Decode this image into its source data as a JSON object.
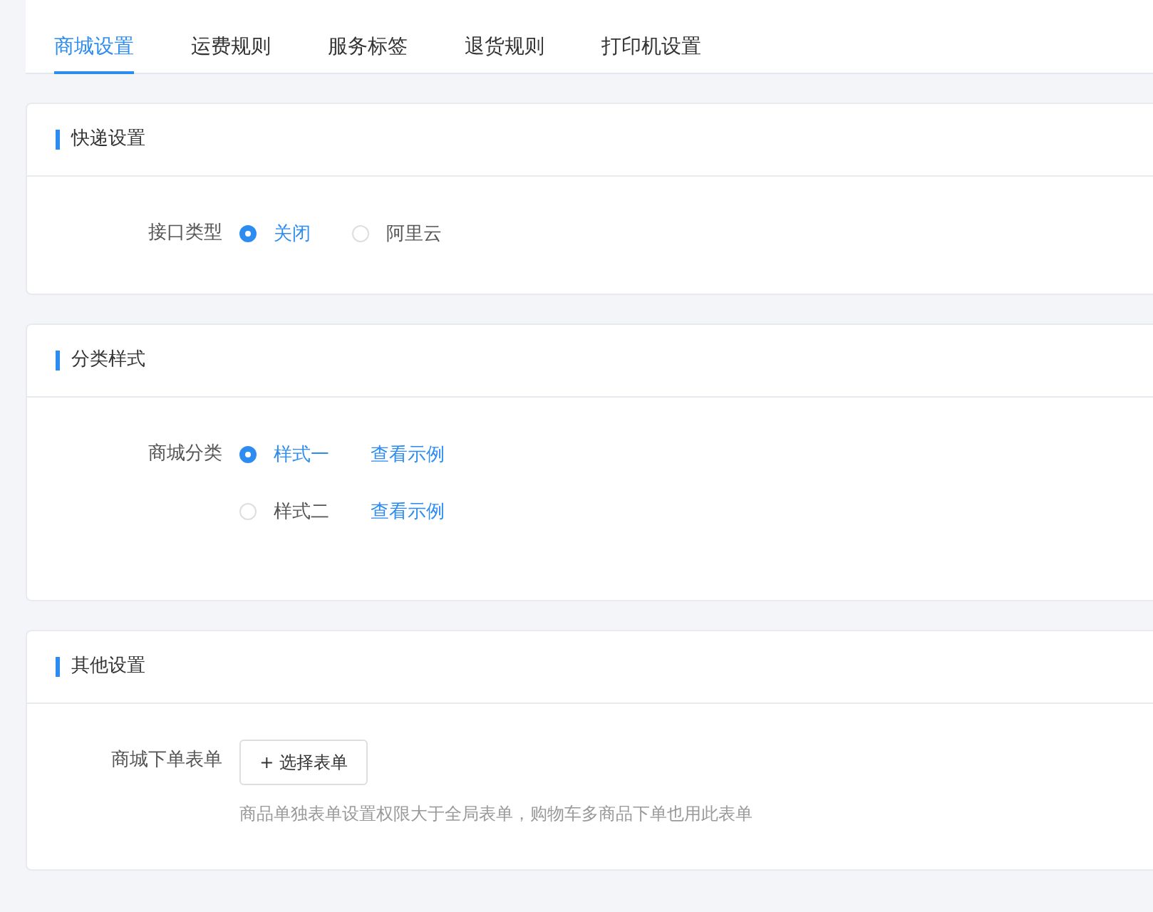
{
  "tabs": [
    {
      "label": "商城设置",
      "selected": true
    },
    {
      "label": "运费规则",
      "selected": false
    },
    {
      "label": "服务标签",
      "selected": false
    },
    {
      "label": "退货规则",
      "selected": false
    },
    {
      "label": "打印机设置",
      "selected": false
    }
  ],
  "sections": [
    {
      "title": "快递设置",
      "fields": [
        {
          "kind": "radio",
          "label": "接口类型",
          "options": [
            {
              "label": "关闭",
              "selected": true
            },
            {
              "label": "阿里云",
              "selected": false
            }
          ]
        }
      ]
    },
    {
      "title": "分类样式",
      "fields": [
        {
          "kind": "radio",
          "label": "商城分类",
          "options": [
            {
              "label": "样式一",
              "selected": true,
              "link": "查看示例"
            }
          ]
        },
        {
          "kind": "radio",
          "options": [
            {
              "label": "样式二",
              "selected": false,
              "link": "查看示例"
            }
          ]
        }
      ]
    },
    {
      "title": "其他设置",
      "fields": [
        {
          "kind": "button",
          "label": "商城下单表单",
          "button": "+ 选择表单",
          "hint": "商品单独表单设置权限大于全局表单，购物车多商品下单也用此表单"
        }
      ]
    }
  ]
}
